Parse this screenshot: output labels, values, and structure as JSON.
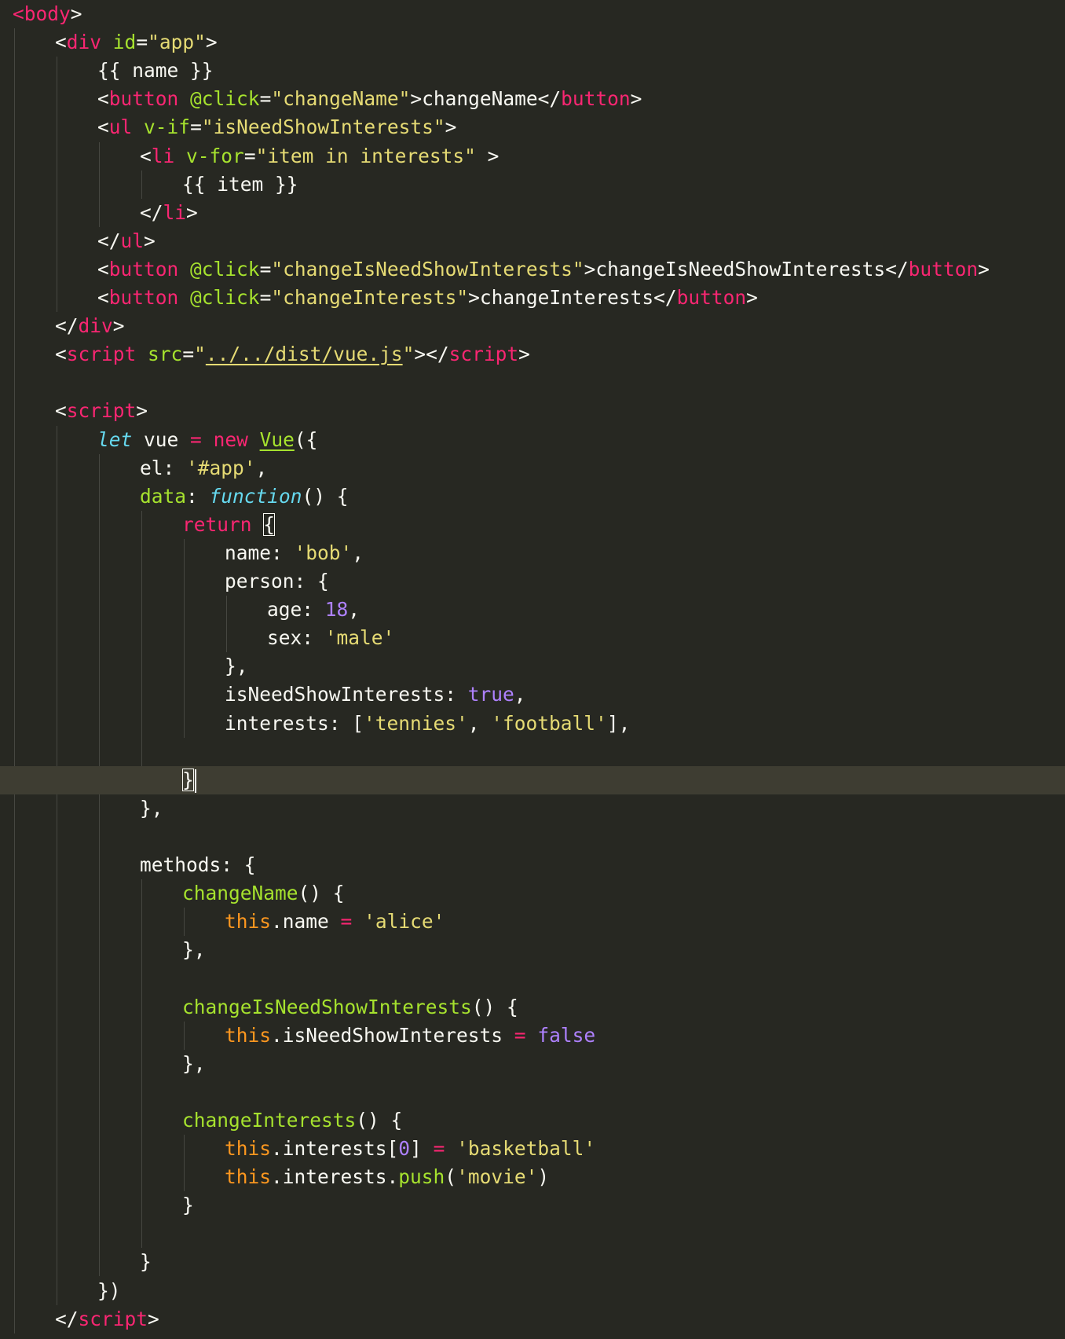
{
  "editor": {
    "theme": "monokai",
    "colors": {
      "background": "#272822",
      "current_line": "#3E3D32",
      "tag": "#F92672",
      "attribute": "#A6E22E",
      "string": "#E6DB74",
      "number": "#AE81FF",
      "storage": "#66D9EF",
      "this": "#FD971F",
      "text": "#F8F8F2"
    },
    "lines": [
      [
        [
          "t",
          "<"
        ],
        [
          "t",
          "body"
        ],
        [
          "p",
          ">"
        ]
      ],
      [
        [
          "p",
          "<"
        ],
        [
          "t",
          "div"
        ],
        [
          "p",
          " "
        ],
        [
          "a",
          "id"
        ],
        [
          "p",
          "="
        ],
        [
          "s",
          "\"app\""
        ],
        [
          "p",
          ">"
        ]
      ],
      [
        [
          "p",
          "{{ name }}"
        ]
      ],
      [
        [
          "p",
          "<"
        ],
        [
          "t",
          "button"
        ],
        [
          "p",
          " "
        ],
        [
          "a",
          "@click"
        ],
        [
          "p",
          "="
        ],
        [
          "s",
          "\"changeName\""
        ],
        [
          "p",
          ">changeName</"
        ],
        [
          "t",
          "button"
        ],
        [
          "p",
          ">"
        ]
      ],
      [
        [
          "p",
          "<"
        ],
        [
          "t",
          "ul"
        ],
        [
          "p",
          " "
        ],
        [
          "a",
          "v-if"
        ],
        [
          "p",
          "="
        ],
        [
          "s",
          "\"isNeedShowInterests\""
        ],
        [
          "p",
          ">"
        ]
      ],
      [
        [
          "p",
          "<"
        ],
        [
          "t",
          "li"
        ],
        [
          "p",
          " "
        ],
        [
          "a",
          "v-for"
        ],
        [
          "p",
          "="
        ],
        [
          "s",
          "\"item in interests\""
        ],
        [
          "p",
          " >"
        ]
      ],
      [
        [
          "p",
          "{{ item }}"
        ]
      ],
      [
        [
          "p",
          "</"
        ],
        [
          "t",
          "li"
        ],
        [
          "p",
          ">"
        ]
      ],
      [
        [
          "p",
          "</"
        ],
        [
          "t",
          "ul"
        ],
        [
          "p",
          ">"
        ]
      ],
      [
        [
          "p",
          "<"
        ],
        [
          "t",
          "button"
        ],
        [
          "p",
          " "
        ],
        [
          "a",
          "@click"
        ],
        [
          "p",
          "="
        ],
        [
          "s",
          "\"changeIsNeedShowInterests\""
        ],
        [
          "p",
          ">changeIsNeedShowInterests</"
        ],
        [
          "t",
          "button"
        ],
        [
          "p",
          ">"
        ]
      ],
      [
        [
          "p",
          "<"
        ],
        [
          "t",
          "button"
        ],
        [
          "p",
          " "
        ],
        [
          "a",
          "@click"
        ],
        [
          "p",
          "="
        ],
        [
          "s",
          "\"changeInterests\""
        ],
        [
          "p",
          ">changeInterests</"
        ],
        [
          "t",
          "button"
        ],
        [
          "p",
          ">"
        ]
      ],
      [
        [
          "p",
          "</"
        ],
        [
          "t",
          "div"
        ],
        [
          "p",
          ">"
        ]
      ],
      [
        [
          "p",
          "<"
        ],
        [
          "t",
          "script"
        ],
        [
          "p",
          " "
        ],
        [
          "a",
          "src"
        ],
        [
          "p",
          "="
        ],
        [
          "s",
          "\""
        ],
        [
          "su",
          "../../dist/vue.js"
        ],
        [
          "s",
          "\""
        ],
        [
          "p",
          "></"
        ],
        [
          "t",
          "script"
        ],
        [
          "p",
          ">"
        ]
      ],
      [],
      [
        [
          "p",
          "<"
        ],
        [
          "t",
          "script"
        ],
        [
          "p",
          ">"
        ]
      ],
      [
        [
          "st",
          "let"
        ],
        [
          "p",
          " vue "
        ],
        [
          "t",
          "="
        ],
        [
          "p",
          " "
        ],
        [
          "t",
          "new"
        ],
        [
          "p",
          " "
        ],
        [
          "au",
          "Vue"
        ],
        [
          "p",
          "({"
        ]
      ],
      [
        [
          "p",
          "el: "
        ],
        [
          "s",
          "'#app'"
        ],
        [
          "p",
          ","
        ]
      ],
      [
        [
          "a",
          "data"
        ],
        [
          "p",
          ": "
        ],
        [
          "st",
          "function"
        ],
        [
          "p",
          "() {"
        ]
      ],
      [
        [
          "t",
          "return"
        ],
        [
          "p",
          " "
        ],
        [
          "pb",
          "{"
        ]
      ],
      [
        [
          "p",
          "name: "
        ],
        [
          "s",
          "'bob'"
        ],
        [
          "p",
          ","
        ]
      ],
      [
        [
          "p",
          "person: {"
        ]
      ],
      [
        [
          "p",
          "age: "
        ],
        [
          "n",
          "18"
        ],
        [
          "p",
          ","
        ]
      ],
      [
        [
          "p",
          "sex: "
        ],
        [
          "s",
          "'male'"
        ]
      ],
      [
        [
          "p",
          "},"
        ]
      ],
      [
        [
          "p",
          "isNeedShowInterests: "
        ],
        [
          "n",
          "true"
        ],
        [
          "p",
          ","
        ]
      ],
      [
        [
          "p",
          "interests: ["
        ],
        [
          "s",
          "'tennies'"
        ],
        [
          "p",
          ", "
        ],
        [
          "s",
          "'football'"
        ],
        [
          "p",
          "],"
        ]
      ],
      [],
      [
        [
          "pb",
          "}"
        ],
        [
          "caret",
          ""
        ]
      ],
      [
        [
          "p",
          "},"
        ]
      ],
      [],
      [
        [
          "p",
          "methods: {"
        ]
      ],
      [
        [
          "a",
          "changeName"
        ],
        [
          "p",
          "() {"
        ]
      ],
      [
        [
          "v",
          "this"
        ],
        [
          "p",
          ".name "
        ],
        [
          "t",
          "="
        ],
        [
          "p",
          " "
        ],
        [
          "s",
          "'alice'"
        ]
      ],
      [
        [
          "p",
          "},"
        ]
      ],
      [],
      [
        [
          "a",
          "changeIsNeedShowInterests"
        ],
        [
          "p",
          "() {"
        ]
      ],
      [
        [
          "v",
          "this"
        ],
        [
          "p",
          ".isNeedShowInterests "
        ],
        [
          "t",
          "="
        ],
        [
          "p",
          " "
        ],
        [
          "n",
          "false"
        ]
      ],
      [
        [
          "p",
          "},"
        ]
      ],
      [],
      [
        [
          "a",
          "changeInterests"
        ],
        [
          "p",
          "() {"
        ]
      ],
      [
        [
          "v",
          "this"
        ],
        [
          "p",
          ".interests["
        ],
        [
          "n",
          "0"
        ],
        [
          "p",
          "] "
        ],
        [
          "t",
          "="
        ],
        [
          "p",
          " "
        ],
        [
          "s",
          "'basketball'"
        ]
      ],
      [
        [
          "v",
          "this"
        ],
        [
          "p",
          ".interests."
        ],
        [
          "a",
          "push"
        ],
        [
          "p",
          "("
        ],
        [
          "s",
          "'movie'"
        ],
        [
          "p",
          ")"
        ]
      ],
      [
        [
          "p",
          "}"
        ]
      ],
      [],
      [
        [
          "p",
          "}"
        ]
      ],
      [
        [
          "p",
          "})"
        ]
      ],
      [
        [
          "p",
          "</"
        ],
        [
          "t",
          "script"
        ],
        [
          "p",
          ">"
        ]
      ],
      [
        [
          "p",
          "</"
        ],
        [
          "t",
          "body"
        ],
        [
          "p",
          ">"
        ]
      ]
    ]
  }
}
